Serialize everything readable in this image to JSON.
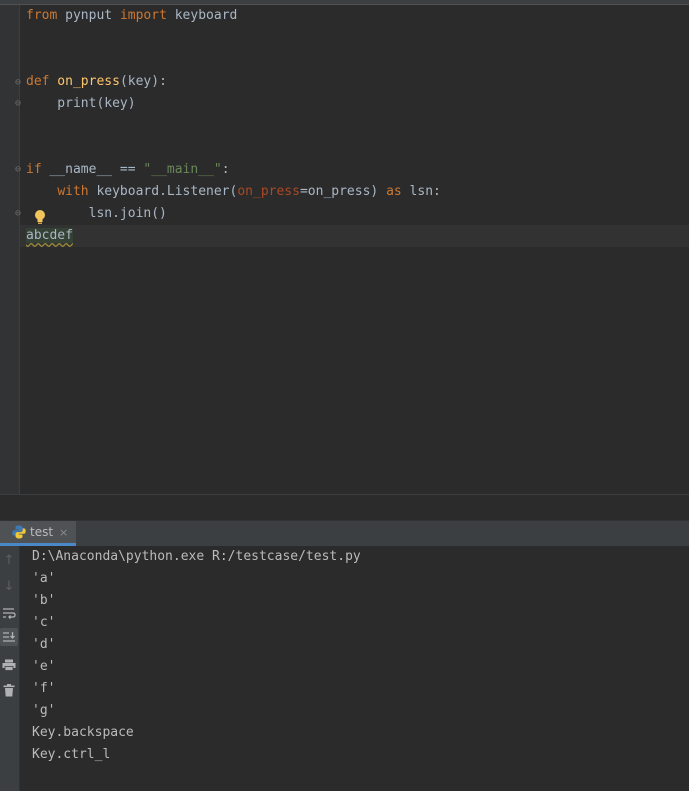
{
  "editor": {
    "lines": {
      "l1": {
        "kw_from": "from",
        "mod": " pynput ",
        "kw_import": "import",
        "name": " keyboard"
      },
      "l4": {
        "kw_def": "def",
        "fn": " on_press",
        "args": "(key):"
      },
      "l5": {
        "text": "    print(key)"
      },
      "l8": {
        "kw_if": "if",
        "mid": " __name__ == ",
        "str": "\"__main__\"",
        "end": ":"
      },
      "l9": {
        "indent": "    ",
        "kw_with": "with",
        "a": " keyboard.Listener(",
        "param": "on_press",
        "b": "=on_press) ",
        "kw_as": "as",
        "c": " lsn:"
      },
      "l10": {
        "text": "        lsn.join()"
      },
      "l11": {
        "text": "abcdef"
      }
    }
  },
  "run": {
    "tab_label": "test",
    "close_glyph": "×",
    "output": [
      "D:\\Anaconda\\python.exe R:/testcase/test.py",
      "'a'",
      "'b'",
      "'c'",
      "'d'",
      "'e'",
      "'f'",
      "'g'",
      "Key.backspace",
      "Key.ctrl_l"
    ]
  },
  "colors": {
    "background": "#2b2b2b",
    "keyword": "#cc7832",
    "function": "#ffc66d",
    "string": "#6a8759",
    "parameter": "#aa4926",
    "text": "#a9b7c6"
  },
  "icons": [
    "lightbulb-icon",
    "python-icon",
    "arrow-up-icon",
    "arrow-down-icon",
    "soft-wrap-icon",
    "scroll-to-end-icon",
    "print-icon",
    "trash-icon",
    "fold-icon"
  ]
}
